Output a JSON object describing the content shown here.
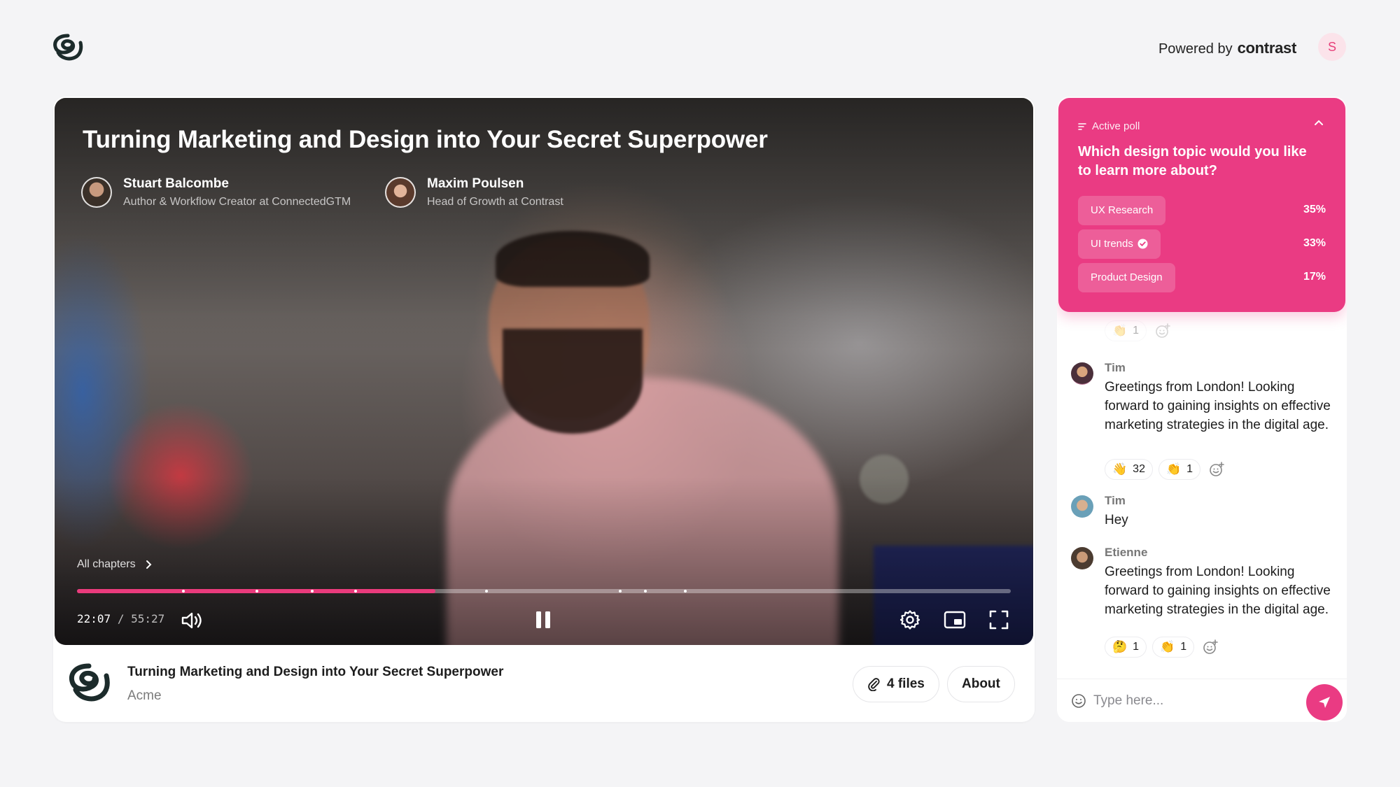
{
  "header": {
    "powered_prefix": "Powered by",
    "powered_brand": "contrast",
    "user_initial": "S"
  },
  "video": {
    "title": "Turning Marketing and Design into Your Secret Superpower",
    "speakers": [
      {
        "name": "Stuart Balcombe",
        "role": "Author & Workflow Creator at ConnectedGTM"
      },
      {
        "name": "Maxim Poulsen",
        "role": "Head of Growth at Contrast"
      }
    ],
    "chapters_label": "All chapters",
    "current_time": "22:07",
    "separator": "/",
    "duration": "55:27",
    "progress_fraction": 0.384
  },
  "info": {
    "title": "Turning Marketing and Design into Your Secret Superpower",
    "organizer": "Acme",
    "files_label": "4 files",
    "about_label": "About"
  },
  "poll": {
    "label": "Active poll",
    "question": "Which design topic would you like to learn more about?",
    "options": [
      {
        "label": "UX Research",
        "percent": "35%",
        "value": 35,
        "selected": false
      },
      {
        "label": "UI trends",
        "percent": "33%",
        "value": 33,
        "selected": true
      },
      {
        "label": "Product Design",
        "percent": "17%",
        "value": 17,
        "selected": false
      }
    ]
  },
  "chat": {
    "partial_reactions": [
      {
        "emoji": "👏",
        "count": "1"
      }
    ],
    "messages": [
      {
        "author": "Tim",
        "text": "Greetings from London! Looking forward to gaining insights on effective marketing strategies in the digital age.",
        "reactions": [
          {
            "emoji": "👋",
            "count": "32"
          },
          {
            "emoji": "👏",
            "count": "1"
          }
        ]
      },
      {
        "author": "Tim",
        "text": "Hey",
        "reactions": []
      },
      {
        "author": "Etienne",
        "text": "Greetings from London! Looking forward to gaining insights on effective marketing strategies in the digital age.",
        "reactions": [
          {
            "emoji": "🤔",
            "count": "1"
          },
          {
            "emoji": "👏",
            "count": "1"
          }
        ]
      }
    ],
    "input_placeholder": "Type here..."
  },
  "colors": {
    "accent": "#ea3b83",
    "background": "#f4f4f6",
    "brand_dark": "#1c2b2b"
  }
}
